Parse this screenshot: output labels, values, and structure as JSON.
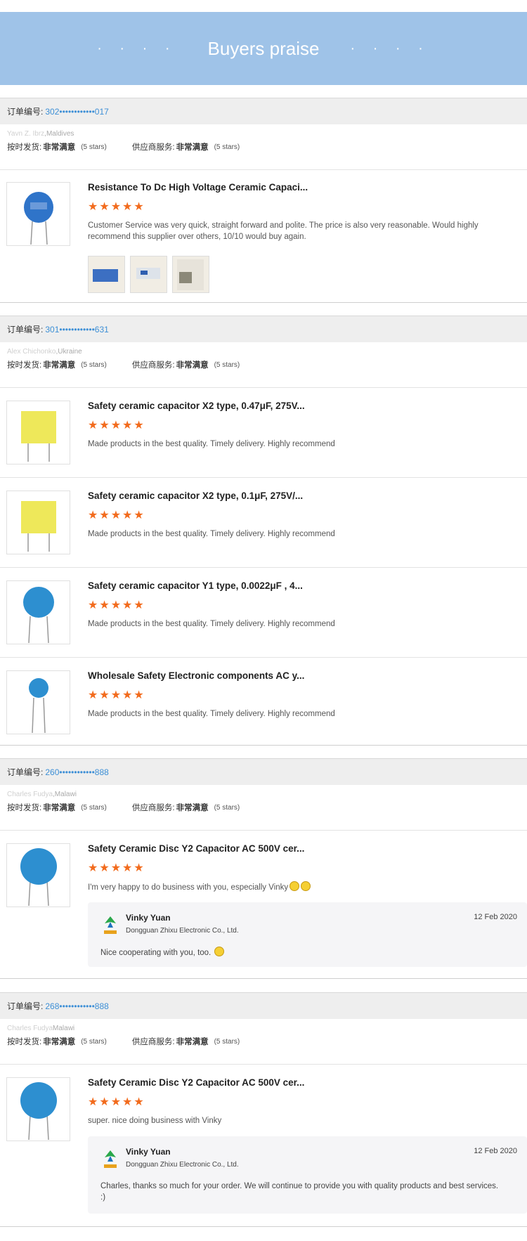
{
  "banner": {
    "title": "Buyers praise",
    "dots_left": "· · · ·",
    "dots_right": "· · · ·"
  },
  "labels": {
    "order_no": "订单编号:",
    "on_time": "按时发货:",
    "supplier": "供应商服务:",
    "very_satisfied": "非常满意",
    "five_stars": "(5 stars)"
  },
  "stars": "★★★★★",
  "orders": [
    {
      "order_no": "302••••••••••••017",
      "buyer_name": "Yavn Z. Ibrz",
      "buyer_country": ",Maldives",
      "items": [
        {
          "title": "Resistance To Dc High Voltage Ceramic Capaci...",
          "comment": "Customer Service was very quick, straight forward and polite. The price is also very reasonable. Would highly recommend this supplier over others, 10/10 would buy again."
        }
      ]
    },
    {
      "order_no": "301••••••••••••631",
      "buyer_name": "Alex Chichonko",
      "buyer_country": ",Ukraine",
      "items": [
        {
          "title": "Safety ceramic capacitor X2 type, 0.47μF, 275V...",
          "comment": "Made products in the best quality. Timely delivery. Highly recommend"
        },
        {
          "title": "Safety ceramic capacitor X2 type, 0.1μF, 275V/...",
          "comment": "Made products in the best quality. Timely delivery. Highly recommend"
        },
        {
          "title": "Safety ceramic capacitor Y1 type, 0.0022μF , 4...",
          "comment": "Made products in the best quality. Timely delivery. Highly recommend"
        },
        {
          "title": "Wholesale Safety Electronic components AC y...",
          "comment": "Made products in the best quality. Timely delivery. Highly recommend"
        }
      ]
    },
    {
      "order_no": "260••••••••••••888",
      "buyer_name": "Charles Fudya",
      "buyer_country": ",Malawi",
      "items": [
        {
          "title": "Safety Ceramic Disc Y2 Capacitor AC 500V cer...",
          "comment": "I'm very happy to do business with you, especially Vinky"
        }
      ],
      "reply": {
        "name": "Vinky Yuan",
        "company": "Dongguan Zhixu Electronic Co., Ltd.",
        "date": "12 Feb 2020",
        "text": "Nice cooperating with you, too."
      }
    },
    {
      "order_no": "268••••••••••••888",
      "buyer_name": "Charles Fudya",
      "buyer_country": "Malawi",
      "items": [
        {
          "title": "Safety Ceramic Disc Y2 Capacitor AC 500V cer...",
          "comment": "super. nice doing business with Vinky"
        }
      ],
      "reply": {
        "name": "Vinky Yuan",
        "company": "Dongguan Zhixu Electronic Co., Ltd.",
        "date": "12 Feb 2020",
        "text": "Charles, thanks so much for your order. We will continue to provide you with quality products and best services. :)"
      }
    }
  ]
}
